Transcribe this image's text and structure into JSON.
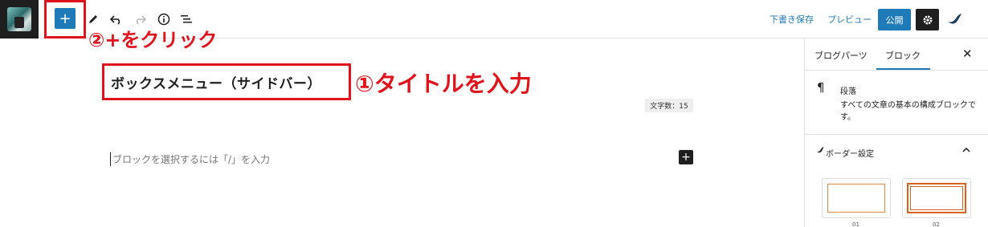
{
  "toolbar": {
    "add_icon": "+",
    "draft_save": "下書き保存",
    "preview": "プレビュー",
    "publish": "公開"
  },
  "annotations": {
    "step2": "②+をクリック",
    "step1": "①タイトルを入力"
  },
  "editor": {
    "title": "ボックスメニュー（サイドバー）",
    "word_count": "文字数：15",
    "placeholder": "ブロックを選択するには「/」を入力",
    "inline_add": "+"
  },
  "sidebar": {
    "tabs": [
      "ブログパーツ",
      "ブロック"
    ],
    "active_tab": "ブロック",
    "close": "✕",
    "block": {
      "icon": "¶",
      "name": "段落",
      "description": "すべての文章の基本の構成ブロックです。"
    },
    "border_panel": {
      "title": "ボーダー設定",
      "options": [
        "01",
        "02"
      ]
    }
  },
  "colors": {
    "accent": "#1f7ab8",
    "annotation_red": "#e0121b",
    "dark": "#1e1e1e"
  }
}
